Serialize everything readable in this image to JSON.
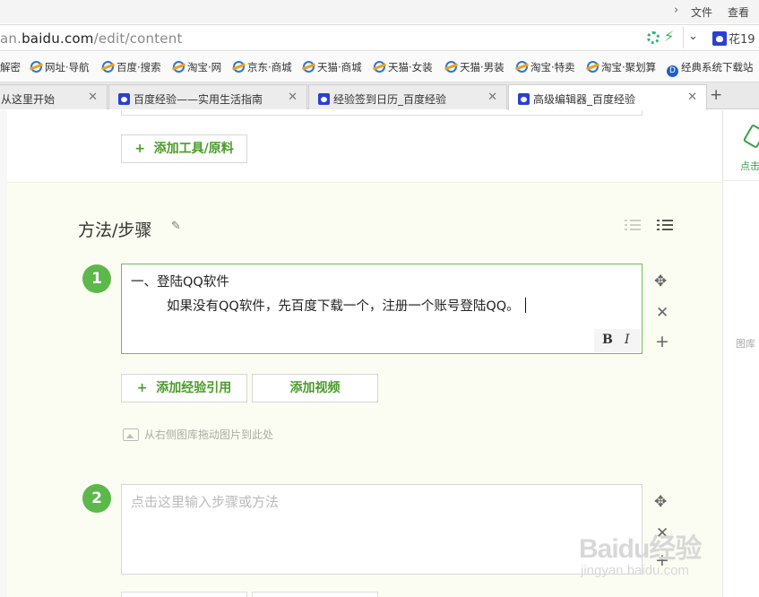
{
  "menu": {
    "items": [
      "文件",
      "查看"
    ]
  },
  "address": {
    "url_prefix": "an.",
    "url_domain": "baidu.com",
    "url_path": "/edit/content",
    "user": "花19"
  },
  "bookmarks": [
    "解密",
    "网址·导航",
    "百度·搜索",
    "淘宝·网",
    "京东·商城",
    "天猫·商城",
    "天猫·女装",
    "天猫·男装",
    "淘宝·特卖",
    "淘宝·聚划算",
    "经典系统下载站"
  ],
  "tabs": [
    {
      "label": "从这里开始"
    },
    {
      "label": "百度经验——实用生活指南"
    },
    {
      "label": "经验签到日历_百度经验"
    },
    {
      "label": "高级编辑器_百度经验"
    }
  ],
  "editor": {
    "add_tool_label": "添加工具/原料",
    "section_title": "方法/步骤",
    "steps": [
      {
        "number": "1",
        "line1": "一、登陆QQ软件",
        "line2": "如果没有QQ软件，先百度下载一个，注册一个账号登陆QQ。"
      },
      {
        "number": "2",
        "placeholder": "点击这里输入步骤或方法"
      }
    ],
    "add_ref_label": "添加经验引用",
    "add_video_label": "添加视频",
    "drag_hint": "从右侧图库拖动图片到此处",
    "bold_label": "B",
    "italic_label": "I"
  },
  "right_panel": {
    "top_label": "点击",
    "gallery_label": "图库"
  },
  "watermark": {
    "logo": "Baidu经验",
    "url": "jingyan.baidu.com"
  }
}
